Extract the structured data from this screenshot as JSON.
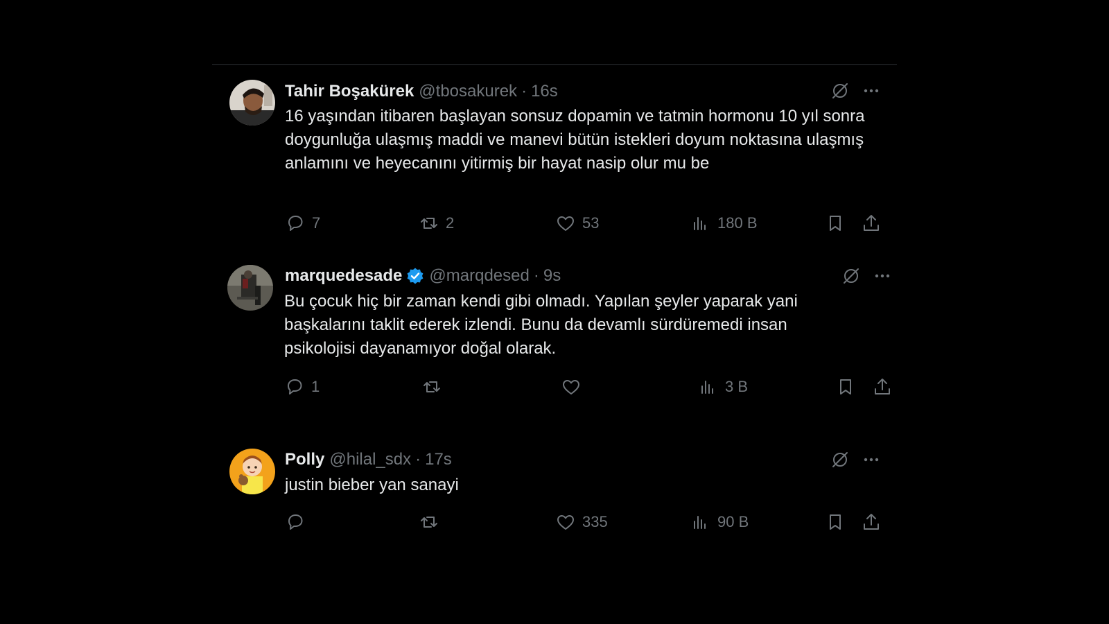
{
  "colors": {
    "background": "#000000",
    "text_primary": "#e7e9ea",
    "text_secondary": "#71767b",
    "verified_blue": "#1d9bf0",
    "divider": "#2f3336"
  },
  "tweets": [
    {
      "name": "Tahir Boşakürek",
      "handle": "@tbosakurek",
      "separator": "·",
      "time": "16s",
      "verified": false,
      "text": "16 yaşından itibaren başlayan sonsuz dopamin ve tatmin hormonu 10 yıl sonra doygunluğa ulaşmış maddi ve manevi bütün istekleri doyum noktasına ulaşmış anlamını ve heyecanını yitirmiş bir hayat nasip olur mu be",
      "replies": "7",
      "reposts": "2",
      "likes": "53",
      "views": "180 B"
    },
    {
      "name": "marquedesade",
      "handle": "@marqdesed",
      "separator": "·",
      "time": "9s",
      "verified": true,
      "text": "Bu çocuk hiç bir zaman kendi gibi olmadı. Yapılan şeyler yaparak yani başkalarını taklit ederek izlendi. Bunu da devamlı sürdüremedi insan psikolojisi dayanamıyor doğal olarak.",
      "replies": "1",
      "reposts": "",
      "likes": "",
      "views": "3 B"
    },
    {
      "name": "Polly",
      "handle": "@hilal_sdx",
      "separator": "·",
      "time": "17s",
      "verified": false,
      "text": "justin bieber yan sanayi",
      "replies": "",
      "reposts": "",
      "likes": "335",
      "views": "90 B"
    }
  ]
}
